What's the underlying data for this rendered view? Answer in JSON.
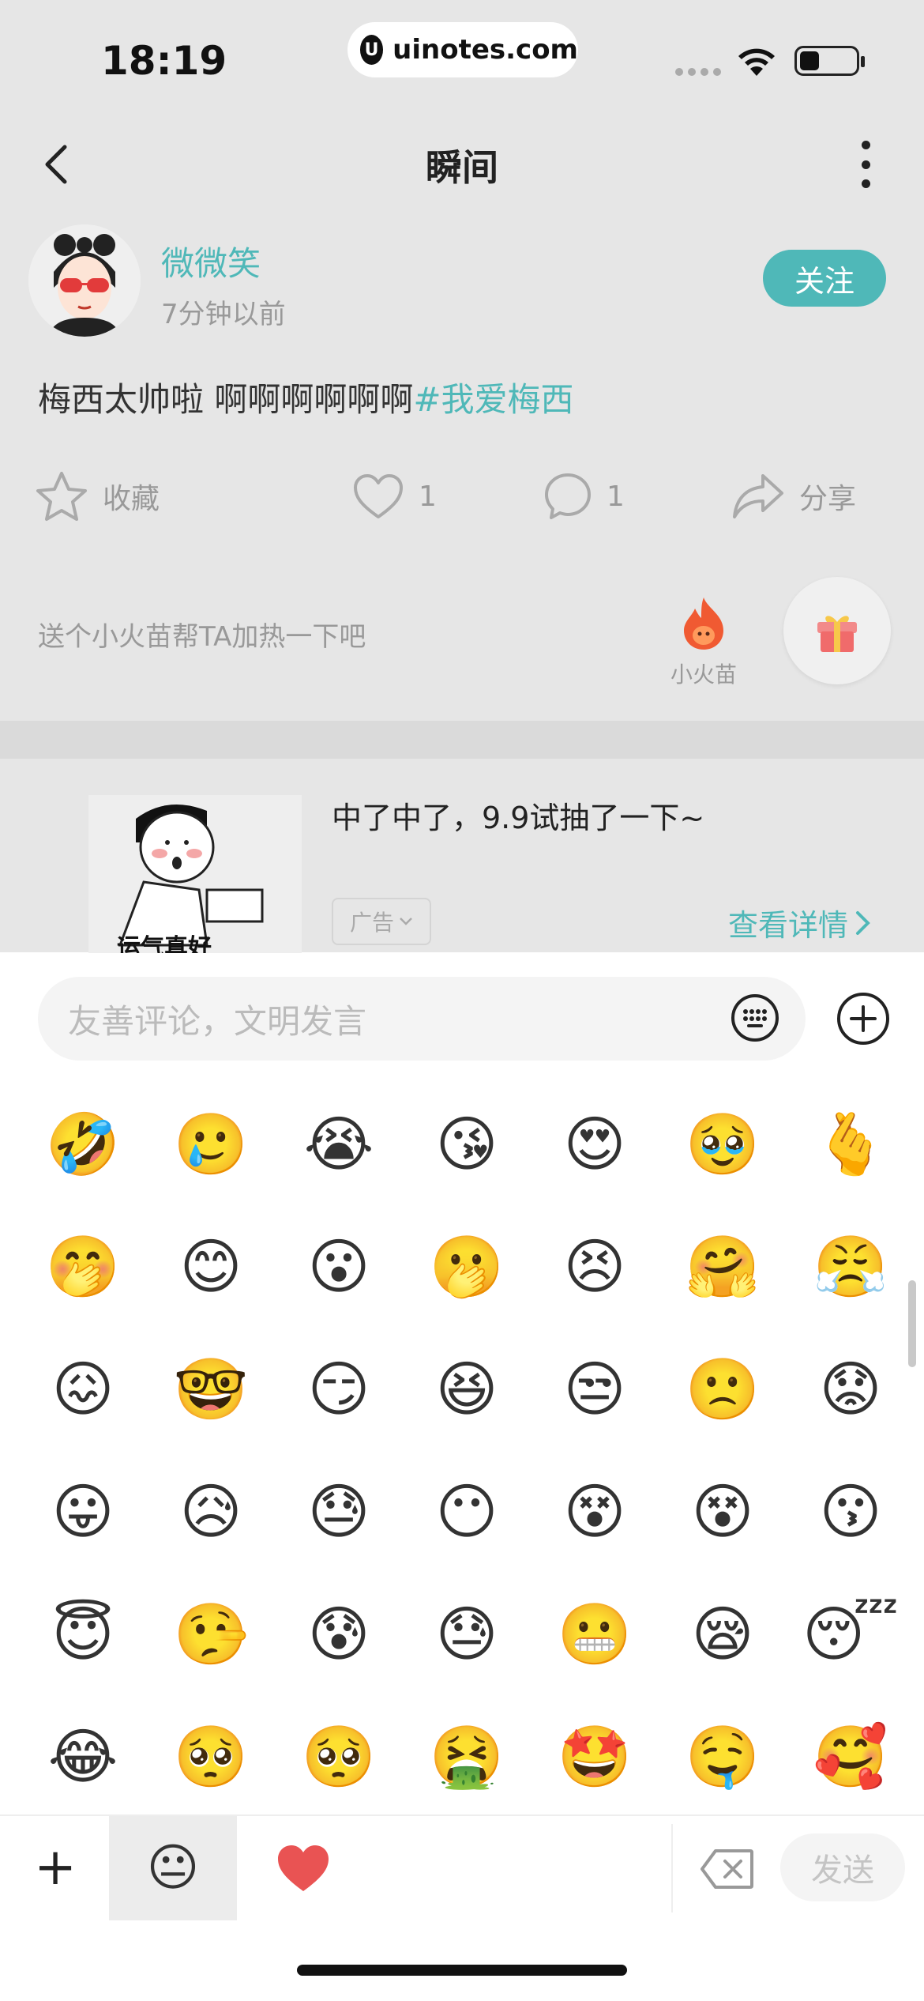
{
  "status_bar": {
    "time": "18:19",
    "url": "uinotes.com",
    "url_logo": "U"
  },
  "nav": {
    "title": "瞬间"
  },
  "post": {
    "username": "微微笑",
    "time_ago": "7分钟以前",
    "follow_label": "关注",
    "text": "梅西太帅啦 啊啊啊啊啊啊",
    "hashtag": "#我爱梅西",
    "actions": {
      "favorite_label": "收藏",
      "like_count": "1",
      "comment_count": "1",
      "share_label": "分享"
    },
    "boost": {
      "prompt": "送个小火苗帮TA加热一下吧",
      "fire_label": "小火苗"
    }
  },
  "ad": {
    "image_caption": "运气真好",
    "title": "中了中了，9.9试抽了一下~",
    "badge_label": "广告",
    "link_label": "查看详情"
  },
  "comment": {
    "placeholder": "友善评论，文明发言"
  },
  "emoji_grid": {
    "rows": [
      [
        "🤣",
        "🥲",
        "😭",
        "😘",
        "😍",
        "🥹",
        "🫰"
      ],
      [
        "🤭",
        "😊",
        "😮",
        "🫢",
        "😣",
        "🤗",
        "😤"
      ],
      [
        "😖",
        "🤓",
        "😏",
        "😆",
        "😒",
        "🙁",
        "😟"
      ],
      [
        "😛",
        "😥",
        "😓",
        "😶",
        "😵",
        "😵",
        "😗"
      ],
      [
        "😇",
        "🤥",
        "😰",
        "😓",
        "😬",
        "😪",
        "😴"
      ],
      [
        "😂",
        "🥺",
        "🥺",
        "🤮",
        "🤩",
        "🤤",
        "🥰"
      ],
      [
        "😀",
        "😀",
        "😈",
        "😀",
        "😀",
        "😀",
        "😀"
      ]
    ]
  },
  "bottom_bar": {
    "plus": "+",
    "emoji_tab": "😐",
    "send_label": "发送"
  },
  "colors": {
    "accent": "#4fb8b8",
    "dim_background": "#e6e6e6",
    "heart": "#e95353",
    "fire": "#f05a32"
  },
  "icons": [
    "back-icon",
    "more-icon",
    "star-icon",
    "heart-icon",
    "comment-icon",
    "share-icon",
    "fire-icon",
    "gift-icon",
    "emoji-keyboard-icon",
    "plus-circle-icon",
    "delete-icon",
    "wifi-icon",
    "battery-icon"
  ]
}
